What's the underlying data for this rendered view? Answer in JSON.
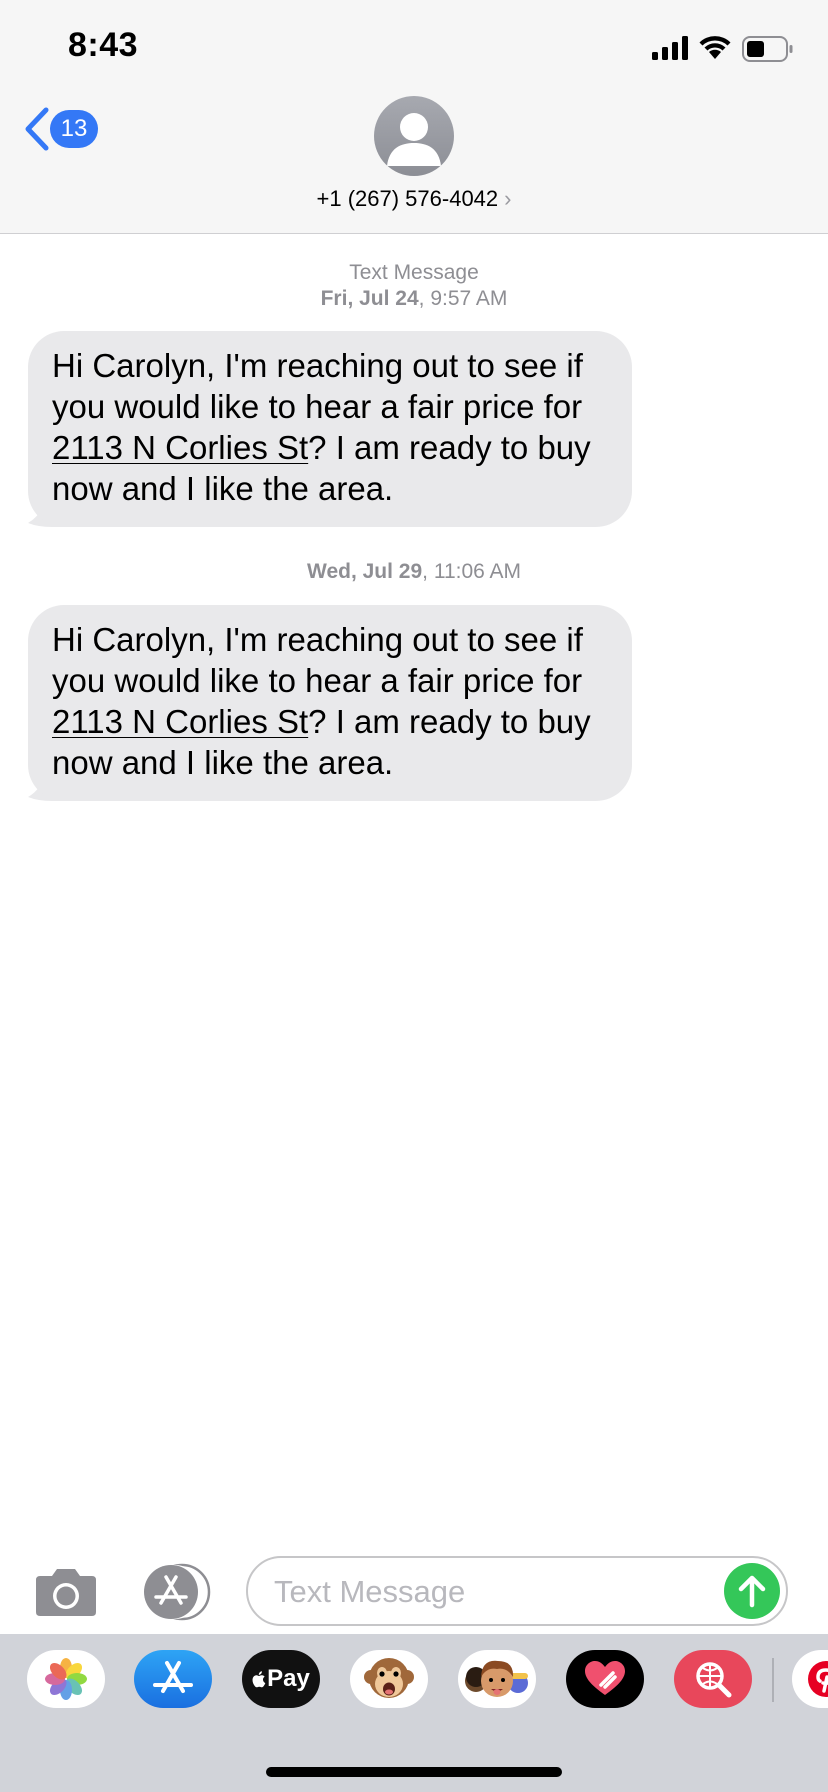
{
  "status_bar": {
    "time": "8:43"
  },
  "header": {
    "back_badge": "13",
    "contact_name": "+1 (267) 576-4042",
    "chevron": "›"
  },
  "thread": {
    "service_label": "Text Message",
    "messages": [
      {
        "date_bold": "Fri, Jul 24",
        "time": ", 9:57 AM",
        "text_before_link": "Hi Carolyn, I'm reaching out to see if you would like to hear a fair price for ",
        "link_text": "2113 N Corlies St",
        "text_after_link": "?  I am ready to buy now and I like the area."
      },
      {
        "date_bold": "Wed, Jul 29",
        "time": ", 11:06 AM",
        "text_before_link": "Hi Carolyn, I'm reaching out to see if you would like to hear a fair price for ",
        "link_text": "2113 N Corlies St",
        "text_after_link": "?  I am ready to buy now and I like the area."
      }
    ]
  },
  "composer": {
    "placeholder": "Text Message",
    "send_color": "#34c759"
  },
  "app_drawer": {
    "apple_pay_label": "Pay",
    "apps": [
      "photos-icon",
      "app-store-icon",
      "apple-pay-icon",
      "animoji-monkey-icon",
      "memoji-icon",
      "heart-digital-touch-icon",
      "web-search-icon",
      "pinterest-icon"
    ]
  },
  "colors": {
    "accent": "#3478f6",
    "bubble": "#e9e9eb",
    "header_bg": "#f6f6f6",
    "drawer_bg": "#d1d3d9"
  }
}
